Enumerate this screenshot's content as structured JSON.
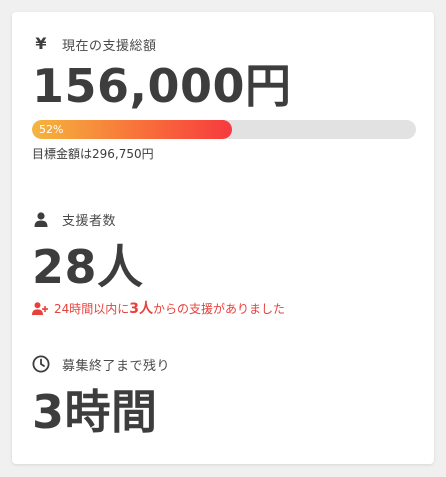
{
  "amount": {
    "label": "現在の支援総額",
    "icon": "yen-icon",
    "value": "156,000円",
    "progress_percent": 52,
    "progress_label": "52%",
    "goal_text": "目標金額は296,750円"
  },
  "supporters": {
    "label": "支援者数",
    "icon": "person-icon",
    "value": "28人",
    "recent": {
      "icon": "person-plus-icon",
      "prefix": "24時間以内に",
      "count": "3人",
      "suffix": "からの支援がありました"
    }
  },
  "time_left": {
    "label": "募集終了まで残り",
    "icon": "clock-icon",
    "value": "3時間"
  },
  "colors": {
    "text": "#3d3d3d",
    "alert": "#e8413b",
    "progress_start": "#f5b53d",
    "progress_end": "#f73a3e",
    "track": "#e2e2e2"
  }
}
